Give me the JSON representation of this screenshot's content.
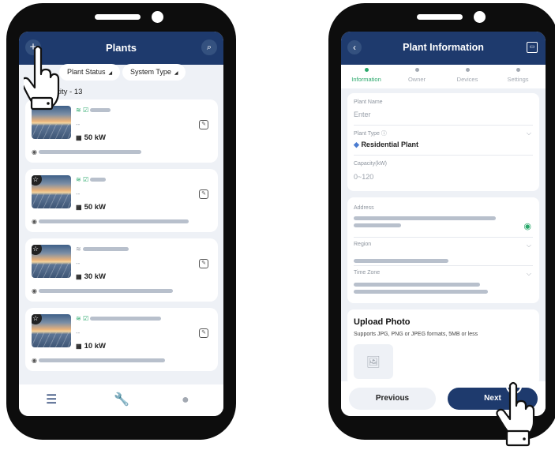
{
  "plants_screen": {
    "title": "Plants",
    "add_icon": "plus-icon",
    "search_icon": "search-icon",
    "filters": [
      "Plant Status",
      "System Type"
    ],
    "quantity_label": "ntity - 13",
    "plants": [
      {
        "name_hidden": true,
        "status_icons": [
          "wifi-icon",
          "check-icon"
        ],
        "placeholder": "--",
        "capacity": "50 kW"
      },
      {
        "name_hidden": true,
        "status_icons": [
          "wifi-icon",
          "check-icon"
        ],
        "placeholder": "--",
        "capacity": "50 kW"
      },
      {
        "name_hidden": true,
        "status_icons": [
          "wifi-off-icon"
        ],
        "placeholder": "--",
        "capacity": "30 kW"
      },
      {
        "name_hidden": true,
        "status_icons": [
          "wifi-icon",
          "check-icon"
        ],
        "placeholder": "--",
        "capacity": "10 kW"
      }
    ],
    "tabbar": [
      "list-icon",
      "wrench-icon",
      "user-icon"
    ]
  },
  "info_screen": {
    "title": "Plant Information",
    "steps": [
      "Information",
      "Owner",
      "Devices",
      "Settings"
    ],
    "active_step": 0,
    "plant_name_label": "Plant Name",
    "plant_name_placeholder": "Enter",
    "plant_type_label": "Plant Type",
    "plant_type_value": "Residential Plant",
    "capacity_label": "Capacity(kW)",
    "capacity_placeholder": "0~120",
    "address_label": "Address",
    "region_label": "Region",
    "timezone_label": "Time Zone",
    "upload_title": "Upload Photo",
    "upload_hint": "Supports JPG, PNG or JPEG formats, 5MB or less",
    "prev_label": "Previous",
    "next_label": "Next"
  },
  "colors": {
    "header": "#1e3a6d",
    "accent_green": "#2aa86b",
    "screen_bg": "#eef1f6"
  }
}
